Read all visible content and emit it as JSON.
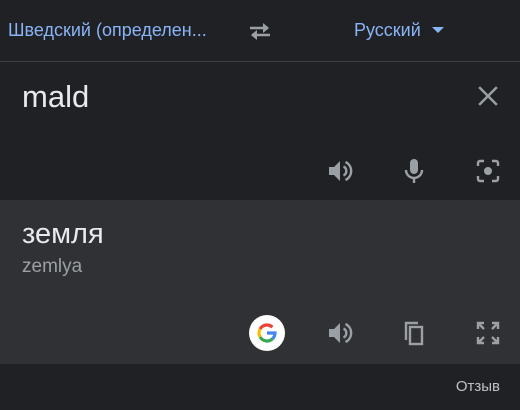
{
  "language_bar": {
    "source_language": "Шведский (определен...",
    "target_language": "Русский",
    "swap_icon": "swap-horiz-icon",
    "caret_icon": "arrow-drop-down-icon"
  },
  "source": {
    "text": "mald",
    "clear_icon": "close-icon",
    "actions": [
      "volume-up-icon",
      "mic-icon",
      "camera-icon"
    ]
  },
  "result": {
    "text": "земля",
    "transliteration": "zemlya",
    "actions": [
      "google-icon",
      "volume-up-icon",
      "copy-icon",
      "fullscreen-icon"
    ]
  },
  "footer": {
    "feedback_label": "Отзыв"
  },
  "colors": {
    "accent": "#8ab4f8",
    "background": "#202124",
    "result_background": "#303134",
    "icon": "#9aa0a6",
    "text": "#e8eaed"
  }
}
